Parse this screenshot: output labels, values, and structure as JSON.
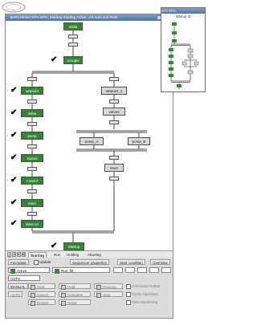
{
  "window": {
    "title": "BATCH/ruler EPH EPH_Starting Starting Active : Ah Auto and RUN"
  },
  "steps": {
    "initial": "initial",
    "occupied": "occupie",
    "setpoint": "setpoint",
    "valve": "valve",
    "pump": "pump",
    "speed": "Speed",
    "control": "control",
    "level": "level",
    "dose_on": "dose on",
    "setpoint2": "setpoint_2",
    "valve2": "valve2",
    "pump_a": "pump_A",
    "pump_b": "pump_B",
    "level2": "level",
    "startup": "Startup"
  },
  "tabs": [
    {
      "label": "Starting"
    },
    {
      "label": "Run"
    },
    {
      "label": "Holding"
    },
    {
      "label": "Aborting"
    }
  ],
  "toolbar": {
    "faceplate": "Faceplate",
    "update": "Update",
    "sequencer_properties": "Sequencer properties",
    "start_condition": "Start condition",
    "overview": "Overview"
  },
  "status": {
    "state": "Active",
    "step": "Run_fill",
    "mode": "AUTO"
  },
  "controls": {
    "manual": "MANUAL",
    "auto": "AUTO",
    "start": "Start",
    "cancel": "Cancel",
    "restart": "Restart",
    "hold": "Hold",
    "complete": "Complete",
    "reset": "Reset",
    "resume": "Resume",
    "stop": "Stop"
  },
  "options": {
    "command_output": "Command Output",
    "cyclic_operation": "Cyclic Operation",
    "time_monitoring": "Time Monitoring"
  },
  "overview": {
    "title": "EPH EPH...",
    "subtitle": "startup  O"
  }
}
